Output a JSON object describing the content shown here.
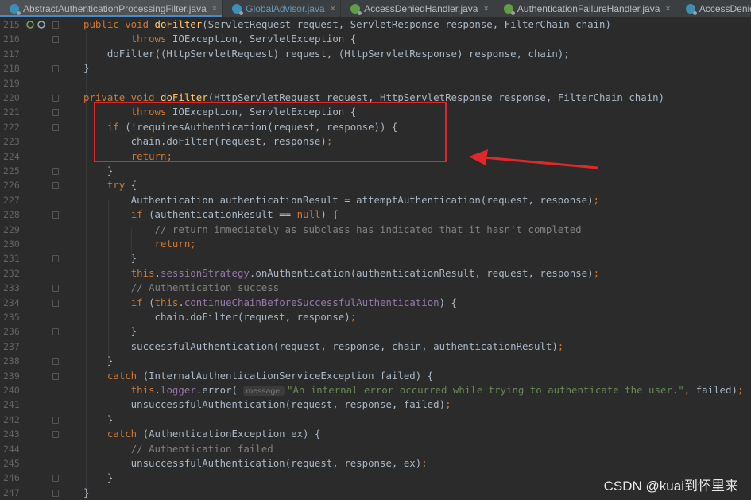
{
  "tabs": [
    {
      "label": "AbstractAuthenticationProcessingFilter.java",
      "icon": "abstract-class-icon",
      "active": true
    },
    {
      "label": "GlobalAdvisor.java",
      "icon": "class-icon",
      "active": false
    },
    {
      "label": "AccessDeniedHandler.java",
      "icon": "interface-icon",
      "active": false
    },
    {
      "label": "AuthenticationFailureHandler.java",
      "icon": "interface-icon",
      "active": false
    },
    {
      "label": "AccessDeniedExceptio",
      "icon": "class-icon",
      "active": false
    }
  ],
  "close_glyph": "×",
  "watermark": "CSDN @kuai到怀里来",
  "lines": [
    {
      "n": "215",
      "parts": [
        [
          "kw",
          "public void "
        ],
        [
          "fn",
          "doFilter"
        ],
        [
          "",
          "(ServletRequest request, ServletResponse response, FilterChain chain)"
        ]
      ]
    },
    {
      "n": "216",
      "parts": [
        [
          "",
          "        "
        ],
        [
          "kw",
          "throws "
        ],
        [
          "",
          "IOException, ServletException {"
        ]
      ]
    },
    {
      "n": "217",
      "parts": [
        [
          "",
          "    doFilter((HttpServletRequest) request, (HttpServletResponse) response, chain);"
        ]
      ]
    },
    {
      "n": "218",
      "parts": [
        [
          "",
          "}"
        ]
      ]
    },
    {
      "n": "219",
      "parts": []
    },
    {
      "n": "220",
      "parts": [
        [
          "kw",
          "private void "
        ],
        [
          "fn",
          "doFilter"
        ],
        [
          "",
          "(HttpServletRequest request, HttpServletResponse response, FilterChain chain)"
        ]
      ]
    },
    {
      "n": "221",
      "parts": [
        [
          "",
          "        "
        ],
        [
          "kw",
          "throws "
        ],
        [
          "",
          "IOException, ServletException {"
        ]
      ]
    },
    {
      "n": "222",
      "parts": [
        [
          "",
          "    "
        ],
        [
          "kw",
          "if "
        ],
        [
          "",
          "(!requiresAuthentication(request, response)) {"
        ]
      ]
    },
    {
      "n": "223",
      "parts": [
        [
          "",
          "        chain.doFilter(request, response)"
        ],
        [
          "kw",
          ";"
        ]
      ]
    },
    {
      "n": "224",
      "parts": [
        [
          "",
          "        "
        ],
        [
          "kw",
          "return;"
        ]
      ]
    },
    {
      "n": "225",
      "parts": [
        [
          "",
          "    }"
        ]
      ]
    },
    {
      "n": "226",
      "parts": [
        [
          "",
          "    "
        ],
        [
          "kw",
          "try "
        ],
        [
          "",
          "{"
        ]
      ]
    },
    {
      "n": "227",
      "parts": [
        [
          "",
          "        Authentication authenticationResult = attemptAuthentication(request, response)"
        ],
        [
          "kw",
          ";"
        ]
      ]
    },
    {
      "n": "228",
      "parts": [
        [
          "",
          "        "
        ],
        [
          "kw",
          "if "
        ],
        [
          "",
          "(authenticationResult == "
        ],
        [
          "kw",
          "null"
        ],
        [
          "",
          ") {"
        ]
      ]
    },
    {
      "n": "229",
      "parts": [
        [
          "",
          "            "
        ],
        [
          "cm",
          "// return immediately as subclass has indicated that it hasn't completed"
        ]
      ]
    },
    {
      "n": "230",
      "parts": [
        [
          "",
          "            "
        ],
        [
          "kw",
          "return;"
        ]
      ]
    },
    {
      "n": "231",
      "parts": [
        [
          "",
          "        }"
        ]
      ]
    },
    {
      "n": "232",
      "parts": [
        [
          "",
          "        "
        ],
        [
          "kw",
          "this"
        ],
        [
          "",
          "."
        ],
        [
          "fld",
          "sessionStrategy"
        ],
        [
          "",
          ".onAuthentication(authenticationResult, request, response)"
        ],
        [
          "kw",
          ";"
        ]
      ]
    },
    {
      "n": "233",
      "parts": [
        [
          "",
          "        "
        ],
        [
          "cm",
          "// Authentication success"
        ]
      ]
    },
    {
      "n": "234",
      "parts": [
        [
          "",
          "        "
        ],
        [
          "kw",
          "if "
        ],
        [
          "",
          "("
        ],
        [
          "kw",
          "this"
        ],
        [
          "",
          "."
        ],
        [
          "fld",
          "continueChainBeforeSuccessfulAuthentication"
        ],
        [
          "",
          ") {"
        ]
      ]
    },
    {
      "n": "235",
      "parts": [
        [
          "",
          "            chain.doFilter(request, response)"
        ],
        [
          "kw",
          ";"
        ]
      ]
    },
    {
      "n": "236",
      "parts": [
        [
          "",
          "        }"
        ]
      ]
    },
    {
      "n": "237",
      "parts": [
        [
          "",
          "        successfulAuthentication(request, response, chain, authenticationResult)"
        ],
        [
          "kw",
          ";"
        ]
      ]
    },
    {
      "n": "238",
      "parts": [
        [
          "",
          "    }"
        ]
      ]
    },
    {
      "n": "239",
      "parts": [
        [
          "",
          "    "
        ],
        [
          "kw",
          "catch "
        ],
        [
          "",
          "(InternalAuthenticationServiceException failed) {"
        ]
      ]
    },
    {
      "n": "240",
      "parts": [
        [
          "",
          "        "
        ],
        [
          "kw",
          "this"
        ],
        [
          "",
          "."
        ],
        [
          "fld",
          "logger"
        ],
        [
          "",
          ".error( "
        ],
        [
          "hint",
          "message:"
        ],
        [
          "str",
          "\"An internal error occurred while trying to authenticate the user.\""
        ],
        [
          "kw",
          ", "
        ],
        [
          "",
          "failed)"
        ],
        [
          "kw",
          ";"
        ]
      ]
    },
    {
      "n": "241",
      "parts": [
        [
          "",
          "        unsuccessfulAuthentication(request, response, failed)"
        ],
        [
          "kw",
          ";"
        ]
      ]
    },
    {
      "n": "242",
      "parts": [
        [
          "",
          "    }"
        ]
      ]
    },
    {
      "n": "243",
      "parts": [
        [
          "",
          "    "
        ],
        [
          "kw",
          "catch "
        ],
        [
          "",
          "(AuthenticationException ex) {"
        ]
      ]
    },
    {
      "n": "244",
      "parts": [
        [
          "",
          "        "
        ],
        [
          "cm",
          "// Authentication failed"
        ]
      ]
    },
    {
      "n": "245",
      "parts": [
        [
          "",
          "        unsuccessfulAuthentication(request, response, ex)"
        ],
        [
          "kw",
          ";"
        ]
      ]
    },
    {
      "n": "246",
      "parts": [
        [
          "",
          "    }"
        ]
      ]
    },
    {
      "n": "247",
      "parts": [
        [
          "",
          "}"
        ]
      ]
    }
  ]
}
